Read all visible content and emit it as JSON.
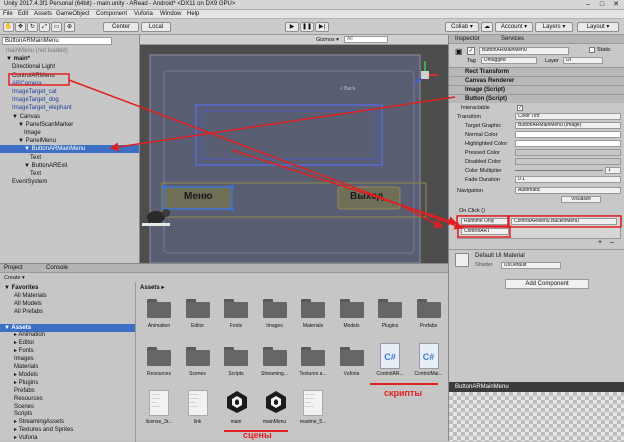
{
  "window": {
    "title": "Unity 2017.4.3f1 Personal (64bit) - main.unity - ARead - Android* <DX11 on DX9 GPU>",
    "controls": [
      "–",
      "□",
      "✕"
    ]
  },
  "menu": [
    "File",
    "Edit",
    "Assets",
    "GameObject",
    "Component",
    "Vuforia",
    "Window",
    "Help"
  ],
  "toolbar": {
    "center_label": "Center",
    "local_label": "Local",
    "collab_label": "Collab ▾",
    "account_label": "Account ▾",
    "layers_label": "Layers ▾",
    "layout_label": "Layout ▾"
  },
  "hierarchy": {
    "search_value": "ButtonARMainMenu",
    "items": [
      {
        "text": "mainMenu (not loaded)",
        "style": "gray",
        "indent": 0
      },
      {
        "text": "▼ main*",
        "style": "bold",
        "indent": 0
      },
      {
        "text": "Directional Light",
        "style": "",
        "indent": 1
      },
      {
        "text": "ControlARMenu",
        "style": "",
        "indent": 1
      },
      {
        "text": "ARCamera",
        "style": "blue",
        "indent": 1
      },
      {
        "text": "ImageTarget_cat",
        "style": "blue",
        "indent": 1
      },
      {
        "text": "ImageTarget_dog",
        "style": "blue",
        "indent": 1
      },
      {
        "text": "ImageTarget_elephant",
        "style": "blue",
        "indent": 1
      },
      {
        "text": "▼ Canvas",
        "style": "",
        "indent": 1
      },
      {
        "text": "▼ PanelScanMarker",
        "style": "",
        "indent": 2
      },
      {
        "text": "Image",
        "style": "",
        "indent": 3
      },
      {
        "text": "▼ PanelMenu",
        "style": "",
        "indent": 2
      },
      {
        "text": "▼ ButtonARMainMenu",
        "style": "sel",
        "indent": 3
      },
      {
        "text": "Text",
        "style": "",
        "indent": 4
      },
      {
        "text": "▼ ButtonARExit",
        "style": "",
        "indent": 3
      },
      {
        "text": "Text",
        "style": "",
        "indent": 4
      },
      {
        "text": "EventSystem",
        "style": "",
        "indent": 1
      }
    ]
  },
  "scene": {
    "gizmos_label": "Gizmos ▾",
    "search_placeholder": "All",
    "back_label": "< Back",
    "menu_button": "Меню",
    "exit_button": "Выход"
  },
  "inspector": {
    "tab_inspector": "Inspector",
    "tab_services": "Services",
    "object_name": "ButtonARMainMenu",
    "static_label": "Static",
    "tag_label": "Tag",
    "tag_value": "Untagged",
    "layer_label": "Layer",
    "layer_value": "UI",
    "components": [
      "Rect Transform",
      "Canvas Renderer",
      "Image (Script)",
      "Button (Script)"
    ],
    "interactable_label": "Interactable",
    "transition_label": "Transition",
    "transition_value": "Color Tint",
    "target_graphic_label": "Target Graphic",
    "target_graphic_value": "ButtonARMainMenu (Image)",
    "normal_color_label": "Normal Color",
    "highlighted_color_label": "Highlighted Color",
    "pressed_color_label": "Pressed Color",
    "disabled_color_label": "Disabled Color",
    "color_multiplier_label": "Color Multiplier",
    "color_multiplier_value": "1",
    "fade_duration_label": "Fade Duration",
    "fade_duration_value": "0.1",
    "navigation_label": "Navigation",
    "navigation_value": "Automatic",
    "visualize_label": "Visualize",
    "onclick_label": "On Click ()",
    "runtime_value": "Runtime Only",
    "function_value": "ControlARMenu.BackInMenu",
    "object_ref": "ControlART",
    "material_name": "Default UI Material",
    "shader_label": "Shader",
    "shader_value": "UI/Default",
    "add_component_label": "Add Component",
    "preview_title": "ButtonARMainMenu"
  },
  "project": {
    "tab_project": "Project",
    "tab_console": "Console",
    "create_label": "Create ▾",
    "breadcrumb": "Assets ▸",
    "tree": [
      {
        "text": "▼ Favorites",
        "indent": 0,
        "sel": false,
        "bold": true
      },
      {
        "text": "All Materials",
        "indent": 1,
        "sel": false
      },
      {
        "text": "All Models",
        "indent": 1,
        "sel": false
      },
      {
        "text": "All Prefabs",
        "indent": 1,
        "sel": false
      },
      {
        "text": "",
        "indent": 0,
        "sel": false
      },
      {
        "text": "▼ Assets",
        "indent": 0,
        "sel": true,
        "bold": true
      },
      {
        "text": "▸ Animation",
        "indent": 1,
        "sel": false
      },
      {
        "text": "▸ Editor",
        "indent": 1,
        "sel": false
      },
      {
        "text": "▸ Fonts",
        "indent": 1,
        "sel": false
      },
      {
        "text": "Images",
        "indent": 1,
        "sel": false
      },
      {
        "text": "Materials",
        "indent": 1,
        "sel": false
      },
      {
        "text": "▸ Models",
        "indent": 1,
        "sel": false
      },
      {
        "text": "▸ Plugins",
        "indent": 1,
        "sel": false
      },
      {
        "text": "Prefabs",
        "indent": 1,
        "sel": false
      },
      {
        "text": "Resources",
        "indent": 1,
        "sel": false
      },
      {
        "text": "Scenes",
        "indent": 1,
        "sel": false
      },
      {
        "text": "Scripts",
        "indent": 1,
        "sel": false
      },
      {
        "text": "▸ StreamingAssets",
        "indent": 1,
        "sel": false
      },
      {
        "text": "▸ Textures and Sprites",
        "indent": 1,
        "sel": false
      },
      {
        "text": "▸ Vuforia",
        "indent": 1,
        "sel": false
      }
    ],
    "folders_row1": [
      "Animation",
      "Editor",
      "Fonts",
      "Images",
      "Materials",
      "Models",
      "Plugins",
      "Prefabs"
    ],
    "folders_row2": [
      "Resources",
      "Scenes",
      "Scripts",
      "Streaming...",
      "Textures a...",
      "Vuforia"
    ],
    "scripts_row2": [
      "ControlAR...",
      "ControlMai..."
    ],
    "files_row3": [
      {
        "label": "license_3r...",
        "kind": "doc"
      },
      {
        "label": "link",
        "kind": "doc"
      },
      {
        "label": "main",
        "kind": "unity"
      },
      {
        "label": "mainMenu",
        "kind": "unity"
      },
      {
        "label": "readme_5...",
        "kind": "doc"
      }
    ],
    "annotation_scripts": "скрипты",
    "annotation_scenes": "сцены"
  },
  "colors": {
    "annotation_red": "#e02020",
    "selection_blue": "#3d6fc4",
    "scene_bg": "#4d4d4d",
    "panel_gray": "#c8c8c8"
  }
}
